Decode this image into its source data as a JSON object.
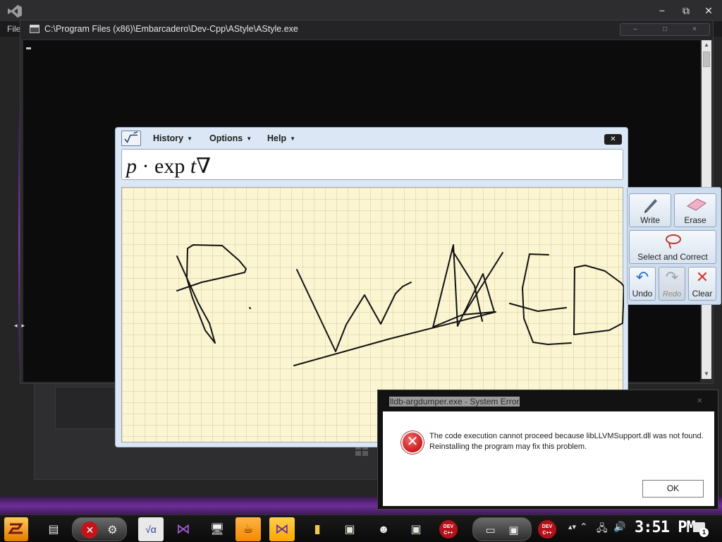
{
  "vs": {
    "menu_file": "File",
    "title_minimize": "−",
    "title_restore": "⧉",
    "title_close": "✕"
  },
  "console": {
    "title": "C:\\Program Files (x86)\\Embarcadero\\Dev-Cpp\\AStyle\\AStyle.exe",
    "ctrl_minimize": "–",
    "ctrl_maximize": "□",
    "ctrl_close": "×"
  },
  "math_input": {
    "menus": [
      {
        "label": "History"
      },
      {
        "label": "Options"
      },
      {
        "label": "Help"
      }
    ],
    "close_label": "✕",
    "preview": {
      "p": "p",
      "dot": "·",
      "exp": "exp",
      "t": "t",
      "nabla": "∇"
    },
    "tools": {
      "write": "Write",
      "erase": "Erase",
      "select_correct": "Select and Correct",
      "undo": "Undo",
      "redo": "Redo",
      "clear": "Clear"
    }
  },
  "error_dialog": {
    "title": "lldb-argdumper.exe - System Error",
    "message": "The code execution cannot proceed because libLLVMSupport.dll was not found. Reinstalling the program may fix this problem.",
    "ok_label": "OK",
    "close_label": "✕"
  },
  "taskbar": {
    "clock": "3:51 PM",
    "dev_label": "DEV C++",
    "notification_count": "1"
  },
  "colors": {
    "console_bg": "#0c0c0c",
    "canvas_bg": "#fbf5d2",
    "taskbar_active": "#f08a00",
    "vs_purple": "#68217a",
    "error_red": "#c81c1c"
  }
}
